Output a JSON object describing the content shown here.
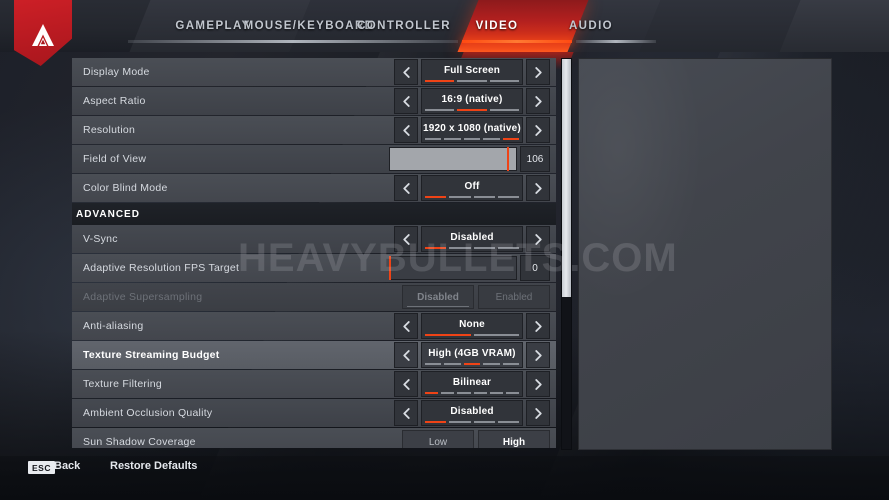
{
  "app": {
    "logo_name": "apex-legends-logo",
    "accent": "#ef4316",
    "accent_bright": "#ff5a1f",
    "panel_bg": "#43464d",
    "selected_row_bg": "#61656d"
  },
  "nav": {
    "tabs": [
      {
        "label": "GAMEPLAY",
        "active": false
      },
      {
        "label": "MOUSE/KEYBOARD",
        "active": false
      },
      {
        "label": "CONTROLLER",
        "active": false
      },
      {
        "label": "VIDEO",
        "active": true
      },
      {
        "label": "AUDIO",
        "active": false
      }
    ]
  },
  "watermark": {
    "text": "HEAVYBULLETS.COM"
  },
  "settings": {
    "section_advanced_label": "ADVANCED",
    "rows": [
      {
        "label": "Display Mode",
        "type": "stepper",
        "value": "Full Screen",
        "segments": 3,
        "active_segment": 1,
        "selected": false,
        "disabled": false
      },
      {
        "label": "Aspect Ratio",
        "type": "stepper",
        "value": "16:9 (native)",
        "segments": 3,
        "active_segment": 2,
        "selected": false,
        "disabled": false
      },
      {
        "label": "Resolution",
        "type": "stepper",
        "value": "1920 x 1080 (native)",
        "segments": 5,
        "active_segment": 5,
        "selected": false,
        "disabled": false
      },
      {
        "label": "Field of View",
        "type": "slider",
        "value": "106",
        "slider_percent": 94,
        "selected": false,
        "disabled": false
      },
      {
        "label": "Color Blind Mode",
        "type": "stepper",
        "value": "Off",
        "segments": 4,
        "active_segment": 1,
        "selected": false,
        "disabled": false
      },
      {
        "label": "V-Sync",
        "type": "stepper",
        "value": "Disabled",
        "segments": 4,
        "active_segment": 1,
        "selected": false,
        "disabled": false,
        "section": "advanced"
      },
      {
        "label": "Adaptive Resolution FPS Target",
        "type": "slider",
        "value": "0",
        "slider_percent": 0,
        "selected": false,
        "disabled": false
      },
      {
        "label": "Adaptive Supersampling",
        "type": "toggle",
        "options": [
          "Disabled",
          "Enabled"
        ],
        "selected_option": 0,
        "selected": false,
        "disabled": true
      },
      {
        "label": "Anti-aliasing",
        "type": "stepper",
        "value": "None",
        "segments": 2,
        "active_segment": 1,
        "selected": false,
        "disabled": false
      },
      {
        "label": "Texture Streaming Budget",
        "type": "stepper",
        "value": "High (4GB VRAM)",
        "segments": 5,
        "active_segment": 3,
        "selected": true,
        "disabled": false
      },
      {
        "label": "Texture Filtering",
        "type": "stepper",
        "value": "Bilinear",
        "segments": 6,
        "active_segment": 1,
        "selected": false,
        "disabled": false
      },
      {
        "label": "Ambient Occlusion Quality",
        "type": "stepper",
        "value": "Disabled",
        "segments": 4,
        "active_segment": 1,
        "selected": false,
        "disabled": false
      },
      {
        "label": "Sun Shadow Coverage",
        "type": "toggle",
        "options": [
          "Low",
          "High"
        ],
        "selected_option": 1,
        "selected": false,
        "disabled": false
      }
    ]
  },
  "scrollbar": {
    "thumb_percent": 61
  },
  "footer": {
    "esc_key": "ESC",
    "back_label": "Back",
    "restore_label": "Restore Defaults"
  }
}
